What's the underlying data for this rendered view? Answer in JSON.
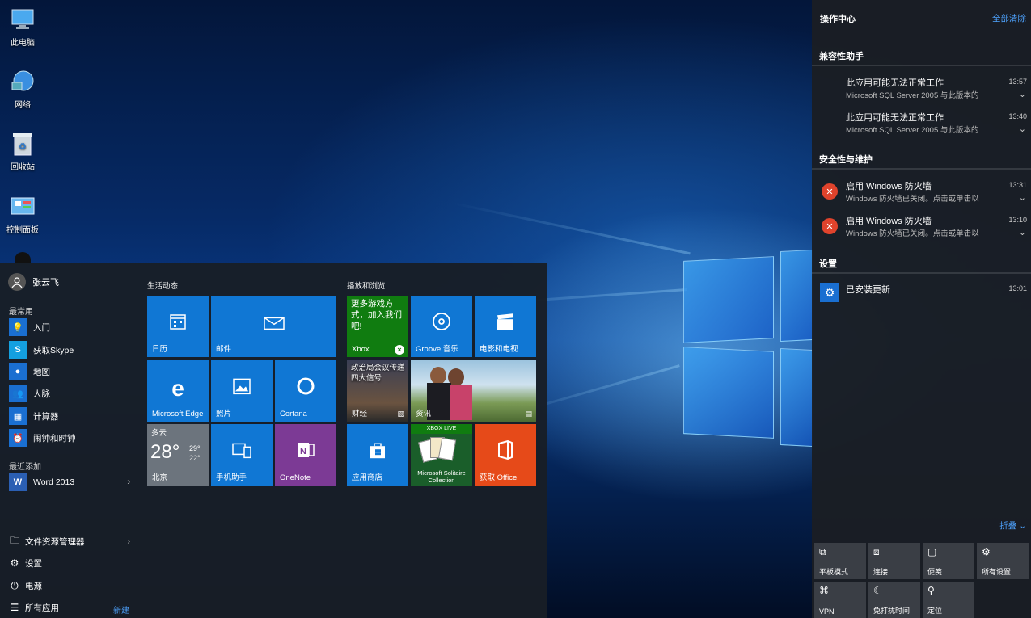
{
  "desktop": {
    "icons": [
      {
        "label": "此电脑",
        "icon": "computer-icon"
      },
      {
        "label": "网络",
        "icon": "network-icon"
      },
      {
        "label": "回收站",
        "icon": "recycle-bin-icon"
      },
      {
        "label": "控制面板",
        "icon": "control-panel-icon"
      }
    ]
  },
  "start": {
    "user_name": "张云飞",
    "most_used_label": "最常用",
    "apps": [
      "入门",
      "获取Skype",
      "地图",
      "人脉",
      "计算器",
      "闹钟和时钟"
    ],
    "recent_label": "最近添加",
    "recent_app": "Word 2013",
    "system": [
      "文件资源管理器",
      "设置",
      "电源",
      "所有应用"
    ],
    "new_label": "新建",
    "group1_title": "生活动态",
    "group2_title": "播放和浏览",
    "tiles": {
      "calendar": "日历",
      "mail": "邮件",
      "edge": "Microsoft Edge",
      "photos": "照片",
      "cortana": "Cortana",
      "weather_cond": "多云",
      "weather_temp": "28°",
      "weather_high": "29°",
      "weather_low": "22°",
      "weather_city": "北京",
      "phone": "手机助手",
      "onenote": "OneNote",
      "xbox_text": "更多游戏方式，加入我们吧!",
      "xbox": "Xbox",
      "groove": "Groove 音乐",
      "movies": "电影和电视",
      "finance_text": "政治局会议传递四大信号",
      "finance": "财经",
      "news": "资讯",
      "store": "应用商店",
      "solitaire_badge": "XBOX LIVE",
      "solitaire": "Microsoft Solitaire Collection",
      "office": "获取 Office"
    }
  },
  "action_center": {
    "title": "操作中心",
    "clear_all": "全部清除",
    "groups": [
      {
        "name": "兼容性助手",
        "items": [
          {
            "title": "此应用可能无法正常工作",
            "body": "Microsoft SQL Server 2005 与此版本的",
            "time": "13:57"
          },
          {
            "title": "此应用可能无法正常工作",
            "body": "Microsoft SQL Server 2005 与此版本的",
            "time": "13:40"
          }
        ]
      },
      {
        "name": "安全性与维护",
        "items": [
          {
            "title": "启用 Windows 防火墙",
            "body": "Windows 防火墙已关闭。点击或单击以",
            "time": "13:31"
          },
          {
            "title": "启用 Windows 防火墙",
            "body": "Windows 防火墙已关闭。点击或单击以",
            "time": "13:10"
          }
        ]
      },
      {
        "name": "设置",
        "items": [
          {
            "title": "已安装更新",
            "body": "",
            "time": "13:01"
          }
        ]
      }
    ],
    "collapse": "折叠",
    "quick_actions": [
      "平板模式",
      "连接",
      "便笺",
      "所有设置",
      "VPN",
      "免打扰时间",
      "定位"
    ]
  }
}
